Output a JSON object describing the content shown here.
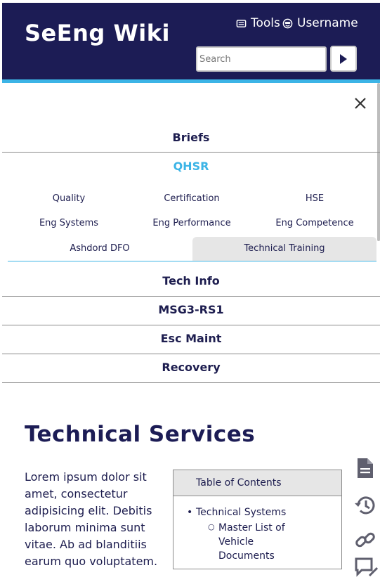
{
  "header": {
    "logo": "SeEng Wiki",
    "tools_label": "Tools",
    "username_label": "Username",
    "search_placeholder": "Search"
  },
  "nav": {
    "items": [
      "Briefs",
      "QHSR",
      "Tech Info",
      "MSG3-RS1",
      "Esc Maint",
      "Recovery"
    ],
    "active_item": "QHSR",
    "subitems": [
      "Quality",
      "Certification",
      "HSE",
      "Eng Systems",
      "Eng Performance",
      "Eng Competence",
      "Ashdord DFO",
      "Technical Training"
    ],
    "active_subitem": "Technical Training"
  },
  "content": {
    "title": "Technical Services",
    "paragraph": "Lorem ipsum dolor sit amet, consectetur adipisicing elit. Debitis laborum minima sunt vitae. Ab ad blanditiis earum quo voluptatem.",
    "toc": {
      "heading": "Table of Contents",
      "items": [
        {
          "label": "Technical Systems",
          "children": [
            "Master List of Vehicle Documents"
          ]
        }
      ]
    }
  },
  "side_icons": [
    "document-icon",
    "history-icon",
    "link-icon",
    "talk-icon"
  ],
  "colors": {
    "header_bg": "#1c1c55",
    "accent": "#3cb4e6",
    "text": "#1d1d4f",
    "active_tab_bg": "#e6e6e6"
  }
}
